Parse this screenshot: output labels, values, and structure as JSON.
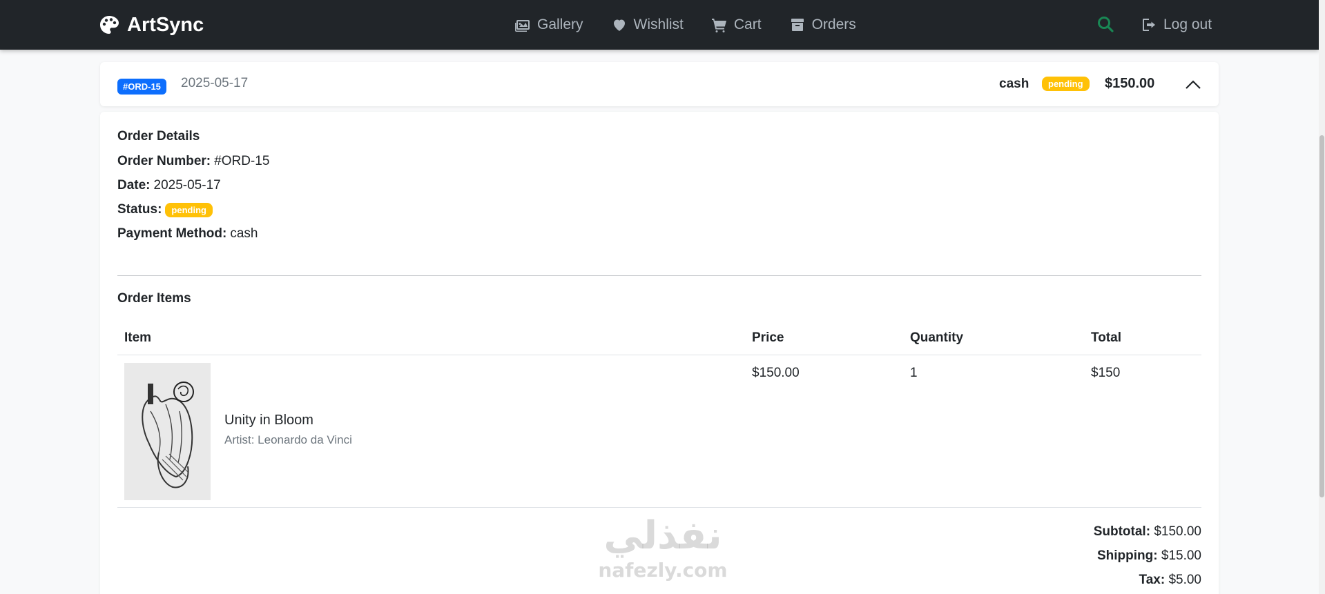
{
  "nav": {
    "brand": "ArtSync",
    "links": [
      {
        "label": "Gallery",
        "icon": "images-icon"
      },
      {
        "label": "Wishlist",
        "icon": "heart-icon"
      },
      {
        "label": "Cart",
        "icon": "cart-icon"
      },
      {
        "label": "Orders",
        "icon": "box-icon"
      }
    ],
    "logout": "Log out"
  },
  "order": {
    "id": "#ORD-15",
    "date": "2025-05-17",
    "payment": "cash",
    "status": "pending",
    "total": "$150.00"
  },
  "details": {
    "title": "Order Details",
    "order_number_label": "Order Number:",
    "order_number": "#ORD-15",
    "date_label": "Date:",
    "date": "2025-05-17",
    "status_label": "Status:",
    "status": "pending",
    "payment_label": "Payment Method:",
    "payment": "cash"
  },
  "items": {
    "title": "Order Items",
    "columns": [
      "Item",
      "Price",
      "Quantity",
      "Total"
    ],
    "rows": [
      {
        "name": "Unity in Bloom",
        "artist": "Artist: Leonardo da Vinci",
        "price": "$150.00",
        "quantity": "1",
        "total": "$150"
      }
    ]
  },
  "summary": {
    "subtotal_label": "Subtotal:",
    "subtotal": "$150.00",
    "shipping_label": "Shipping:",
    "shipping": "$15.00",
    "tax_label": "Tax:",
    "tax": "$5.00"
  },
  "watermark": {
    "arabic": "نفذلي",
    "latin": "nafezly.com"
  },
  "colors": {
    "primary": "#0d6efd",
    "warning": "#ffc107",
    "navbar": "#212529",
    "search": "#198754"
  }
}
